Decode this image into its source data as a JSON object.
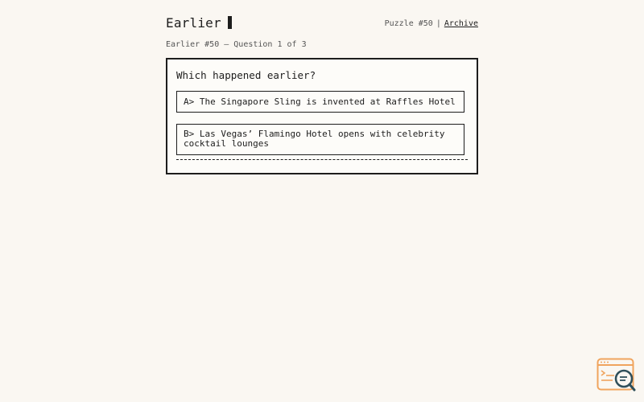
{
  "header": {
    "title": "Earlier",
    "puzzle_label": "Puzzle #50",
    "separator": "|",
    "archive_link": "Archive"
  },
  "subheading": "Earlier #50 — Question 1 of 3",
  "question": {
    "prompt": "Which happened earlier?",
    "options": [
      {
        "label": "A> The Singapore Sling is invented at Raffles Hotel"
      },
      {
        "label": "B> Las Vegas’ Flamingo Hotel opens with celebrity\ncocktail lounges"
      }
    ]
  },
  "widget": {
    "icon": "search-log-icon",
    "colors": {
      "primary": "#f0a45e",
      "secondary": "#2f4f5a"
    }
  }
}
